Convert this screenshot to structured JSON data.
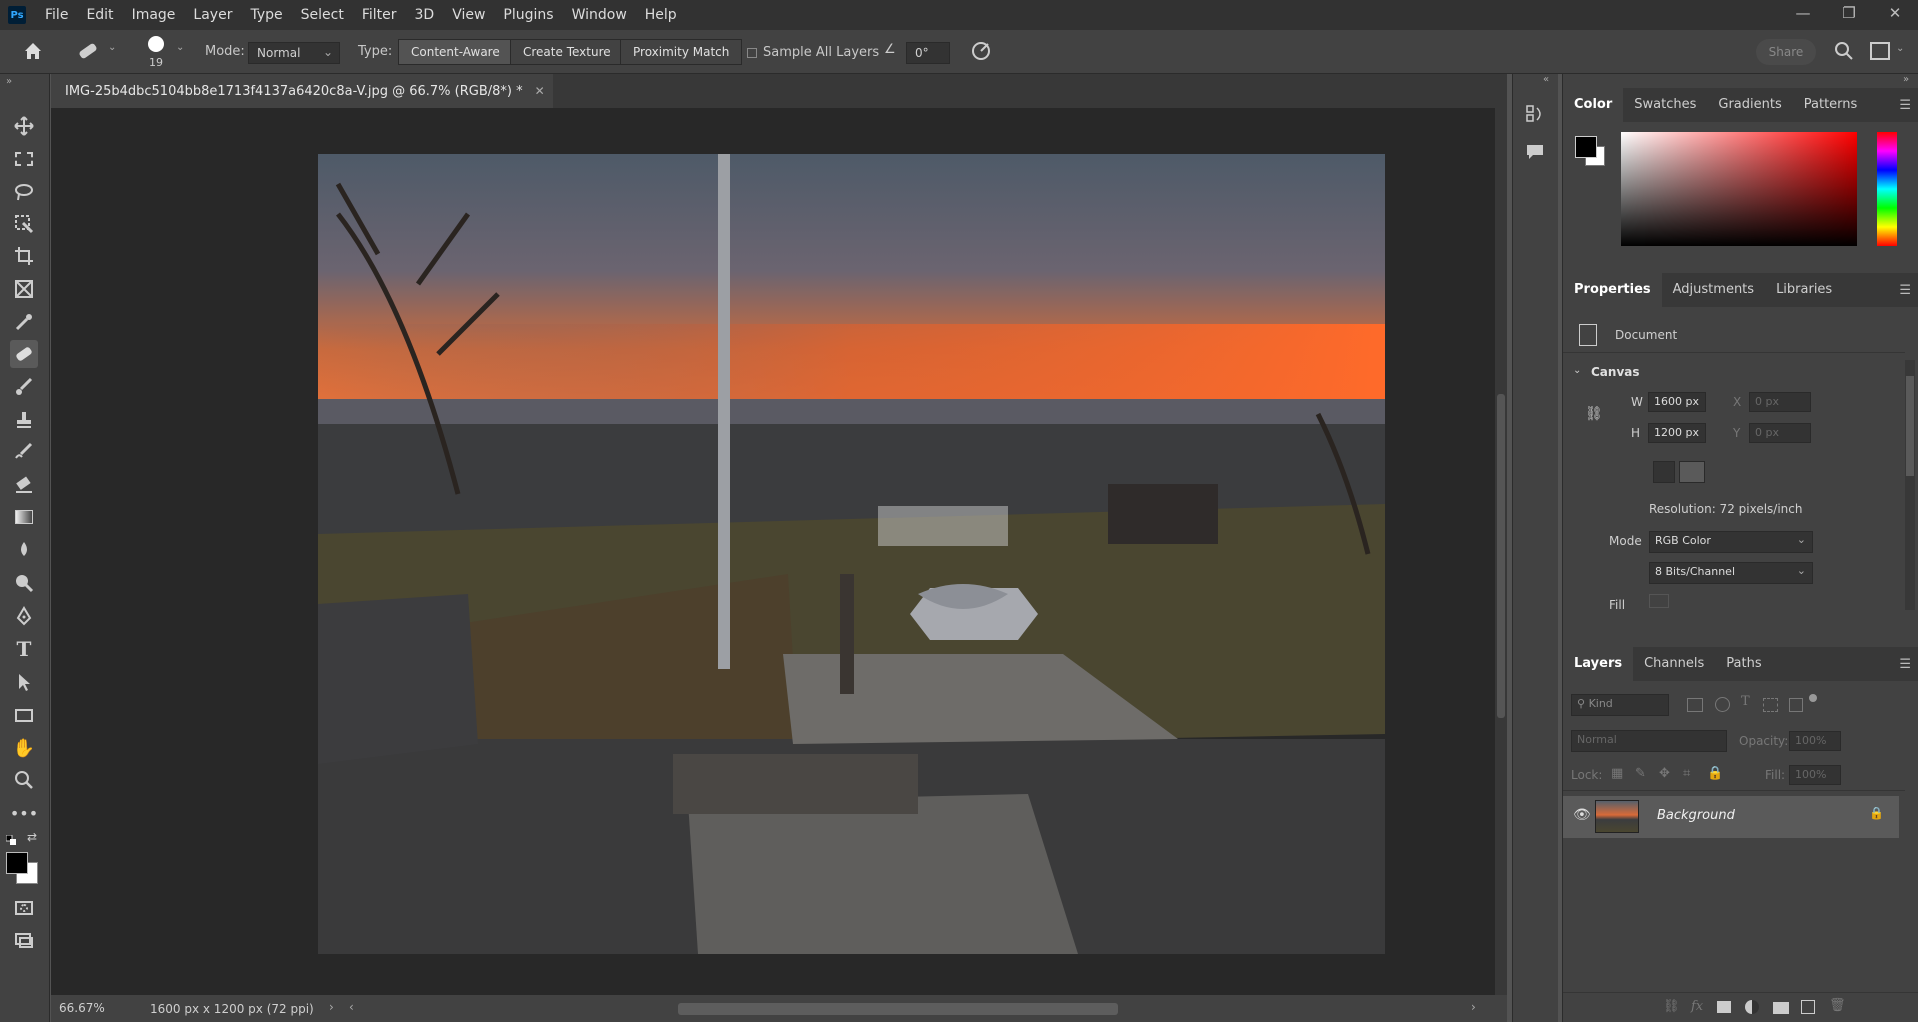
{
  "app": {
    "logo": "Ps"
  },
  "menu": [
    "File",
    "Edit",
    "Image",
    "Layer",
    "Type",
    "Select",
    "Filter",
    "3D",
    "View",
    "Plugins",
    "Window",
    "Help"
  ],
  "options": {
    "brush_size": "19",
    "mode_label": "Mode:",
    "mode_value": "Normal",
    "type_label": "Type:",
    "type_buttons": [
      "Content-Aware",
      "Create Texture",
      "Proximity Match"
    ],
    "sample_all_layers": "Sample All Layers",
    "angle_value": "0°",
    "share_label": "Share"
  },
  "document": {
    "tab_title": "IMG-25b4dbc5104bb8e1713f4137a6420c8a-V.jpg @ 66.7% (RGB/8*) *",
    "zoom": "66.67%",
    "size_info": "1600 px x 1200 px (72 ppi)"
  },
  "color_panel": {
    "tabs": [
      "Color",
      "Swatches",
      "Gradients",
      "Patterns"
    ],
    "foreground": "#000000",
    "background": "#ffffff",
    "hue": "#ff0000"
  },
  "properties_panel": {
    "tabs": [
      "Properties",
      "Adjustments",
      "Libraries"
    ],
    "doc_label": "Document",
    "section": "Canvas",
    "w_label": "W",
    "w_value": "1600 px",
    "h_label": "H",
    "h_value": "1200 px",
    "x_label": "X",
    "x_value": "0 px",
    "y_label": "Y",
    "y_value": "0 px",
    "resolution": "Resolution: 72 pixels/inch",
    "mode_label": "Mode",
    "mode_value": "RGB Color",
    "bits_value": "8 Bits/Channel",
    "fill_label": "Fill"
  },
  "layers_panel": {
    "tabs": [
      "Layers",
      "Channels",
      "Paths"
    ],
    "kind_placeholder": "Kind",
    "blend_mode": "Normal",
    "opacity_label": "Opacity:",
    "opacity_value": "100%",
    "lock_label": "Lock:",
    "fill_label": "Fill:",
    "fill_value": "100%",
    "layers": [
      {
        "name": "Background"
      }
    ]
  }
}
